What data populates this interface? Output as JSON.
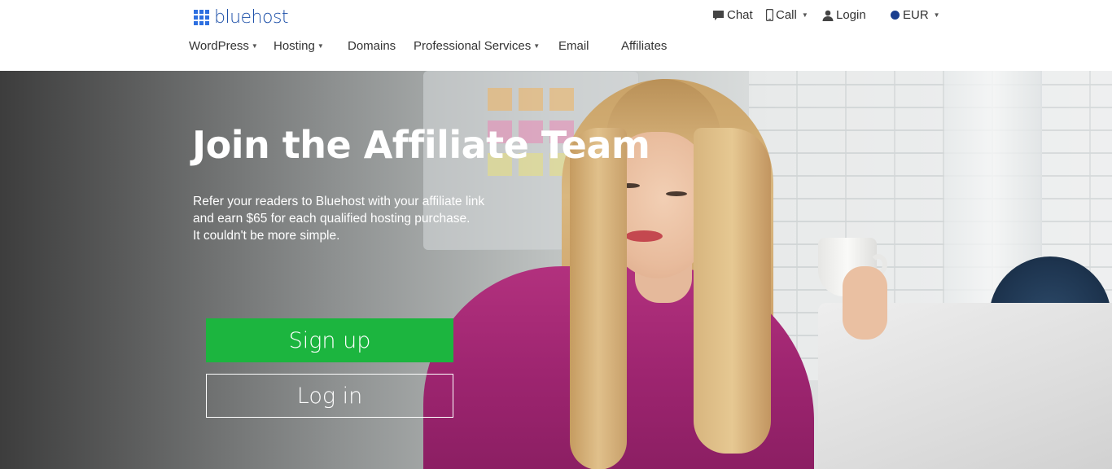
{
  "brand": {
    "name": "bluehost",
    "color": "#2d6fe0"
  },
  "utility_nav": {
    "chat": {
      "label": "Chat",
      "icon": "chat-bubble-icon"
    },
    "call": {
      "label": "Call",
      "icon": "phone-icon"
    },
    "login": {
      "label": "Login",
      "icon": "user-icon"
    },
    "currency": {
      "label": "EUR",
      "icon": "globe-icon"
    }
  },
  "main_nav": {
    "items": [
      {
        "label": "WordPress",
        "has_dropdown": true
      },
      {
        "label": "Hosting",
        "has_dropdown": true
      },
      {
        "label": "Domains",
        "has_dropdown": false
      },
      {
        "label": "Professional Services",
        "has_dropdown": true
      },
      {
        "label": "Email",
        "has_dropdown": false
      },
      {
        "label": "Affiliates",
        "has_dropdown": false
      }
    ]
  },
  "hero": {
    "title": "Join the Affiliate Team",
    "description_lines": [
      "Refer your readers to Bluehost with your affiliate link",
      "and earn $65 for each qualified hosting purchase.",
      "It couldn't be more simple."
    ],
    "signup_label": "Sign up",
    "login_label": "Log in",
    "signup_color": "#1cb53f"
  }
}
